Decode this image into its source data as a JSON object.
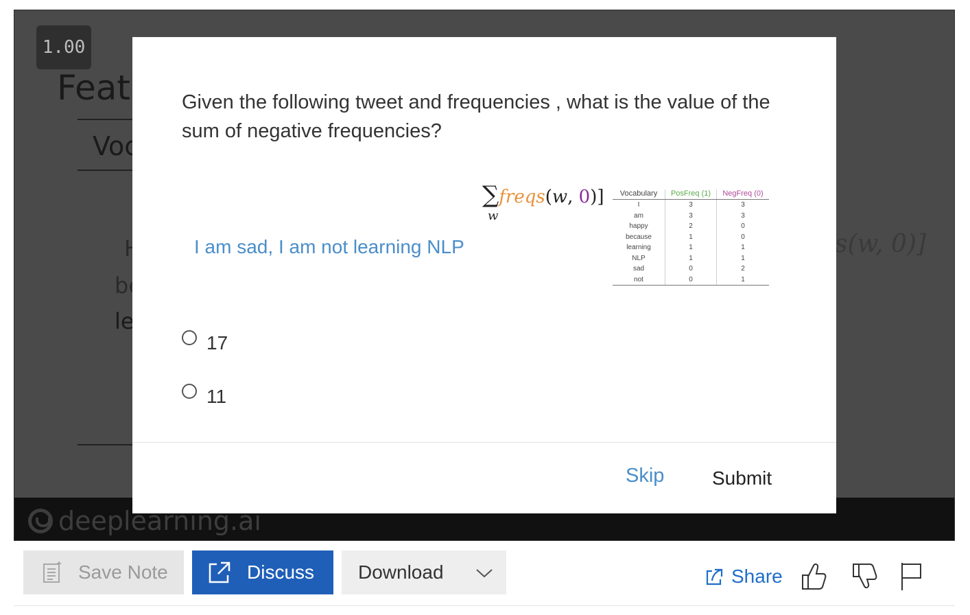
{
  "video": {
    "speed": "1.00",
    "slide_title": "Featu",
    "slide_subtitle": "Voc",
    "slide_partial_h": "H",
    "slide_partial_b": "be",
    "slide_partial_l": "le",
    "slide_partial_formula": "s(w, 0)]",
    "brand": "deeplearning.ai"
  },
  "quiz": {
    "question": "Given the following tweet and frequencies , what is the value of the sum of negative frequencies?",
    "tweet": "I am sad, I am not learning NLP",
    "formula": {
      "sigma": "∑",
      "func": "freqs",
      "open": "(",
      "arg_w": "w",
      "comma": ", ",
      "arg_zero": "0",
      "close": ")]",
      "subscript": "w"
    },
    "table": {
      "headers": [
        "Vocabulary",
        "PosFreq (1)",
        "NegFreq (0)"
      ],
      "rows": [
        [
          "I",
          "3",
          "3"
        ],
        [
          "am",
          "3",
          "3"
        ],
        [
          "happy",
          "2",
          "0"
        ],
        [
          "because",
          "1",
          "0"
        ],
        [
          "learning",
          "1",
          "1"
        ],
        [
          "NLP",
          "1",
          "1"
        ],
        [
          "sad",
          "0",
          "2"
        ],
        [
          "not",
          "0",
          "1"
        ]
      ]
    },
    "options": [
      "17",
      "11"
    ],
    "skip_label": "Skip",
    "submit_label": "Submit"
  },
  "toolbar": {
    "save_note_label": "Save Note",
    "discuss_label": "Discuss",
    "download_label": "Download",
    "share_label": "Share"
  },
  "colors": {
    "accent": "#1f5fb8",
    "link": "#4a8ec9",
    "posfreq": "#5aa84a",
    "negfreq": "#b04a9a"
  }
}
